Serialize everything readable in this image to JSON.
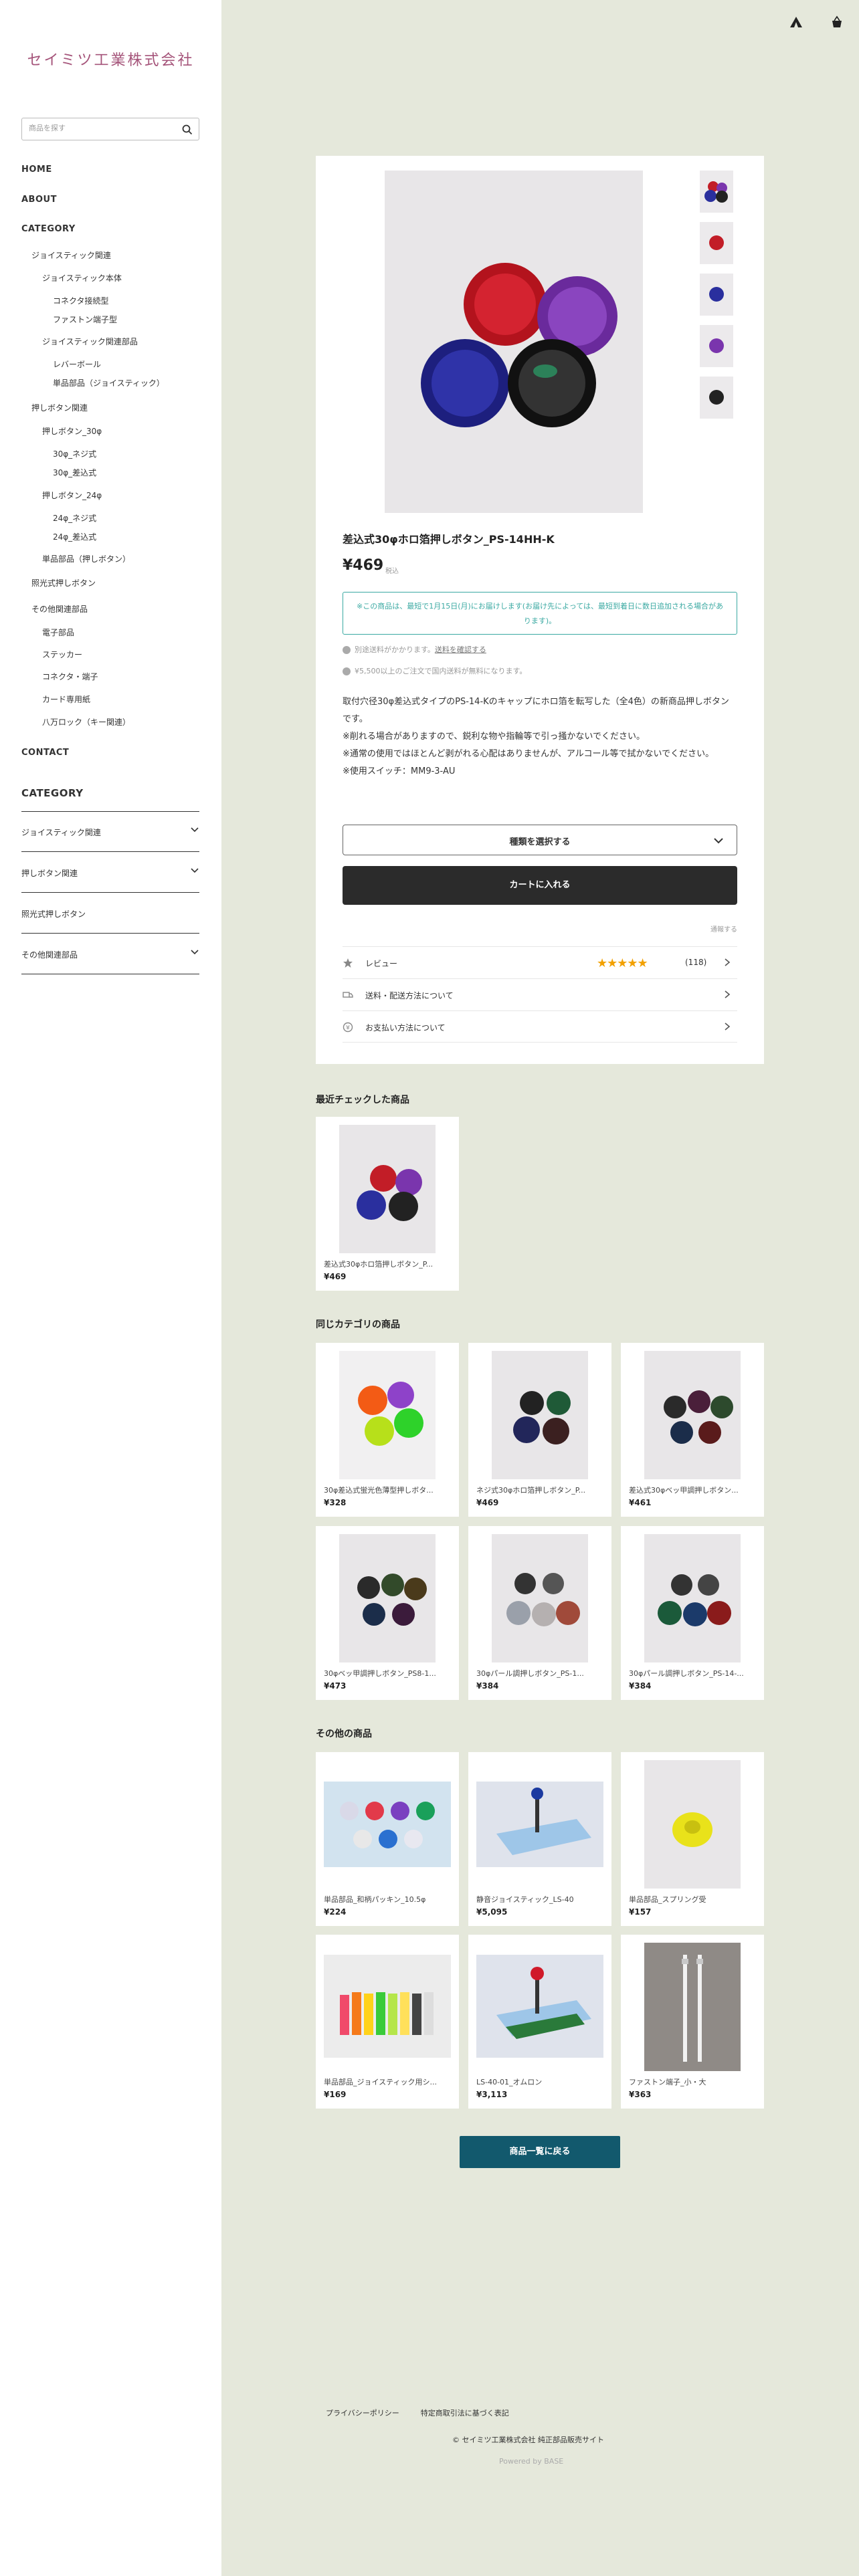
{
  "shop": {
    "name": "セイミツ工業株式会社"
  },
  "search": {
    "placeholder": "商品を探す"
  },
  "nav": {
    "home": "HOME",
    "about": "ABOUT",
    "category": "CATEGORY",
    "contact": "CONTACT"
  },
  "categories": [
    "ジョイスティック関連",
    "ジョイスティック本体",
    "コネクタ接続型",
    "ファストン端子型",
    "ジョイスティック関連部品",
    "レバーボール",
    "単品部品（ジョイスティック）",
    "押しボタン関連",
    "押しボタン_30φ",
    "30φ_ネジ式",
    "30φ_差込式",
    "押しボタン_24φ",
    "24φ_ネジ式",
    "24φ_差込式",
    "単品部品（押しボタン）",
    "照光式押しボタン",
    "その他関連部品",
    "電子部品",
    "ステッカー",
    "コネクタ・端子",
    "カード専用紙",
    "八万ロック（キー関連）"
  ],
  "category2": {
    "title": "CATEGORY",
    "items": [
      "ジョイスティック関連",
      "押しボタン関連",
      "照光式押しボタン",
      "その他関連部品"
    ]
  },
  "product": {
    "title": "差込式30φホロ箔押しボタン_PS-14HH-K",
    "price": "¥469",
    "tax": "税込",
    "shipping_notice": "※この商品は、最短で1月15日(月)にお届けします(お届け先によっては、最短到着日に数日追加される場合があります)。",
    "shipping_fee_note": "別途送料がかかります。",
    "shipping_fee_link": "送料を確認する",
    "free_shipping_note": "¥5,500以上のご注文で国内送料が無料になります。",
    "description": [
      "取付穴径30φ差込式タイプのPS-14-Kのキャップにホロ箔を転写した（全4色）の新商品押しボタンです。",
      "※削れる場合がありますので、鋭利な物や指輪等で引っ掻かないでください。",
      "※通常の使用ではほとんど剥がれる心配はありませんが、アルコール等で拭かないでください。",
      "※使用スイッチ：MM9-3-AU"
    ],
    "variant_label": "種類を選択する",
    "cart_label": "カートに入れる",
    "notify_label": "通報する",
    "review_label": "レビュー",
    "review_stars": "★★★★★",
    "review_count": "(118)",
    "shipping_label": "送料・配送方法について",
    "payment_label": "お支払い方法について"
  },
  "recent": {
    "title": "最近チェックした商品",
    "items": [
      {
        "name": "差込式30φホロ箔押しボタン_P...",
        "price": "¥469"
      }
    ]
  },
  "same_category": {
    "title": "同じカテゴリの商品",
    "items": [
      {
        "name": "30φ差込式蛍光色薄型押しボタ...",
        "price": "¥328"
      },
      {
        "name": "ネジ式30φホロ箔押しボタン_P...",
        "price": "¥469"
      },
      {
        "name": "差込式30φベッ甲調押しボタン...",
        "price": "¥461"
      },
      {
        "name": "30φベッ甲調押しボタン_PS8-1...",
        "price": "¥473"
      },
      {
        "name": "30φパール調押しボタン_PS-1...",
        "price": "¥384"
      },
      {
        "name": "30φパール調押しボタン_PS-14-...",
        "price": "¥384"
      }
    ]
  },
  "other": {
    "title": "その他の商品",
    "items": [
      {
        "name": "単品部品_和柄パッキン_10.5φ",
        "price": "¥224"
      },
      {
        "name": "静音ジョイスティック_LS-40",
        "price": "¥5,095"
      },
      {
        "name": "単品部品_スプリング受",
        "price": "¥157"
      },
      {
        "name": "単品部品_ジョイスティック用シ...",
        "price": "¥169"
      },
      {
        "name": "LS-40-01_オムロン",
        "price": "¥3,113"
      },
      {
        "name": "ファストン端子_小・大",
        "price": "¥363"
      }
    ]
  },
  "back_button": "商品一覧に戻る",
  "footer": {
    "privacy": "プライバシーポリシー",
    "law": "特定商取引法に基づく表記",
    "copyright": "© セイミツ工業株式会社 純正部品販売サイト",
    "powered": "Powered by BASE"
  },
  "colors": {
    "page_bg": "#e5e8db",
    "logo": "#a5547a",
    "accent": "#3aa9a2",
    "back_button": "#12596d",
    "star": "#f2a100"
  }
}
